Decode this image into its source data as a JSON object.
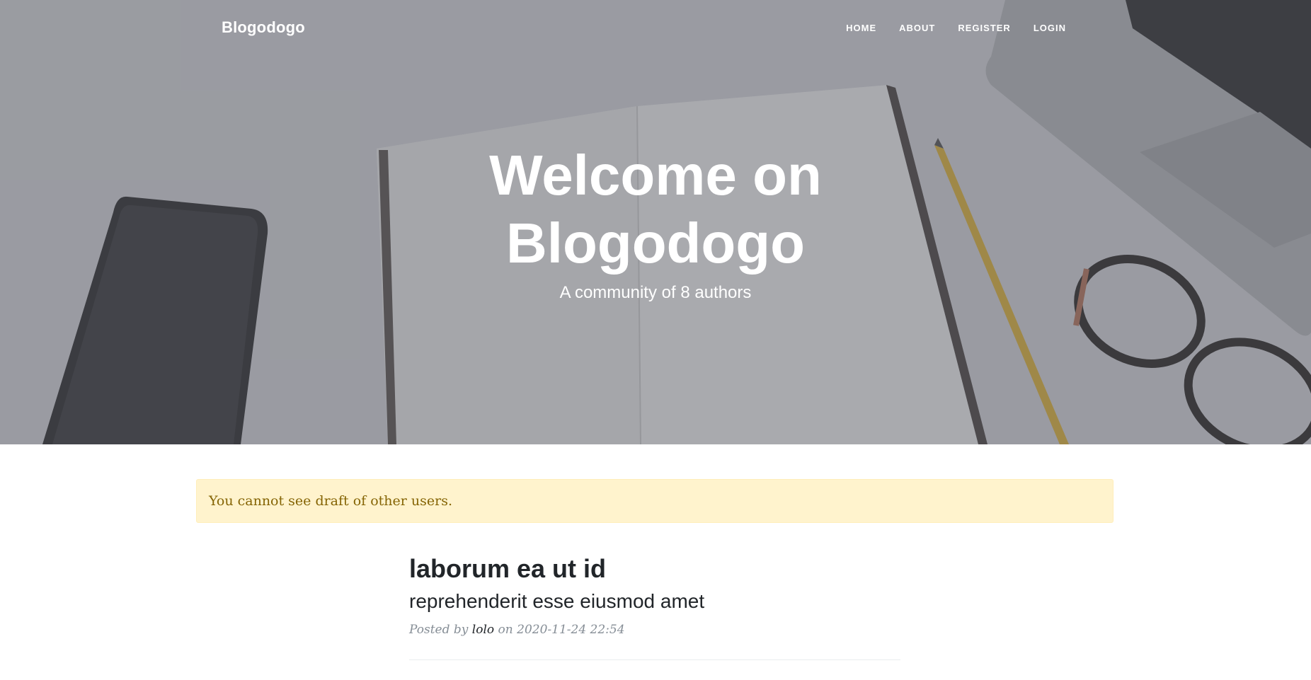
{
  "nav": {
    "brand": "Blogodogo",
    "links": [
      {
        "label": "HOME"
      },
      {
        "label": "ABOUT"
      },
      {
        "label": "REGISTER"
      },
      {
        "label": "LOGIN"
      }
    ]
  },
  "hero": {
    "title": "Welcome on Blogodogo",
    "subtitle": "A community of 8 authors"
  },
  "alert": {
    "message": "You cannot see draft of other users."
  },
  "post": {
    "title": "laborum ea ut id",
    "subtitle": "reprehenderit esse eiusmod amet",
    "posted_by_prefix": "Posted by",
    "author": "lolo",
    "date_prefix": "on",
    "date": "2020-11-24 22:54"
  },
  "colors": {
    "alert_bg": "#fff3cd",
    "alert_text": "#856404",
    "title_text": "#212529",
    "meta_text": "#868e96"
  }
}
